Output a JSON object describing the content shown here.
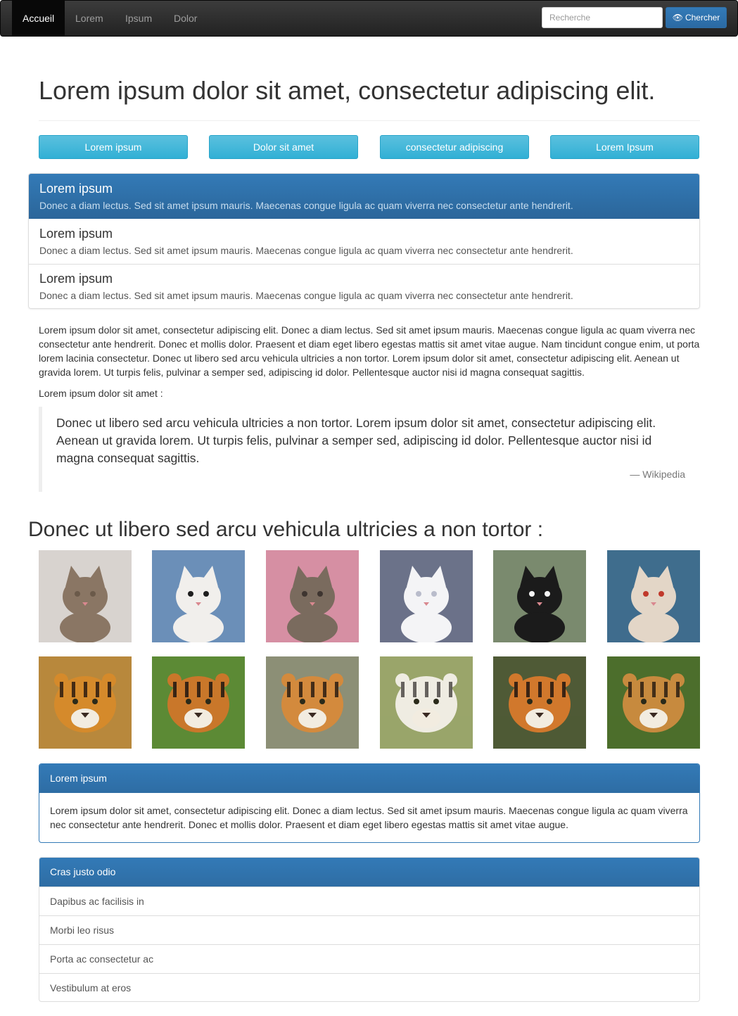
{
  "nav": {
    "items": [
      "Accueil",
      "Lorem",
      "Ipsum",
      "Dolor"
    ],
    "search_placeholder": "Recherche",
    "search_button": "Chercher"
  },
  "page": {
    "title": "Lorem ipsum dolor sit amet, consectetur adipiscing elit.",
    "buttons": [
      "Lorem ipsum",
      "Dolor sit amet",
      "consectetur adipiscing",
      "Lorem Ipsum"
    ]
  },
  "list_group": [
    {
      "heading": "Lorem ipsum",
      "text": "Donec a diam lectus. Sed sit amet ipsum mauris. Maecenas congue ligula ac quam viverra nec consectetur ante hendrerit."
    },
    {
      "heading": "Lorem ipsum",
      "text": "Donec a diam lectus. Sed sit amet ipsum mauris. Maecenas congue ligula ac quam viverra nec consectetur ante hendrerit."
    },
    {
      "heading": "Lorem ipsum",
      "text": "Donec a diam lectus. Sed sit amet ipsum mauris. Maecenas congue ligula ac quam viverra nec consectetur ante hendrerit."
    }
  ],
  "paragraph": "Lorem ipsum dolor sit amet, consectetur adipiscing elit. Donec a diam lectus. Sed sit amet ipsum mauris. Maecenas congue ligula ac quam viverra nec consectetur ante hendrerit. Donec et mollis dolor. Praesent et diam eget libero egestas mattis sit amet vitae augue. Nam tincidunt congue enim, ut porta lorem lacinia consectetur. Donec ut libero sed arcu vehicula ultricies a non tortor. Lorem ipsum dolor sit amet, consectetur adipiscing elit. Aenean ut gravida lorem. Ut turpis felis, pulvinar a semper sed, adipiscing id dolor. Pellentesque auctor nisi id magna consequat sagittis.",
  "intro": "Lorem ipsum dolor sit amet :",
  "blockquote": {
    "text": "Donec ut libero sed arcu vehicula ultricies a non tortor. Lorem ipsum dolor sit amet, consectetur adipiscing elit. Aenean ut gravida lorem. Ut turpis felis, pulvinar a semper sed, adipiscing id dolor. Pellentesque auctor nisi id magna consequat sagittis.",
    "source": "— Wikipedia"
  },
  "section_title": "Donec ut libero sed arcu vehicula ultricies a non tortor :",
  "gallery": {
    "kittens": [
      {
        "bg": "#d8d3cf",
        "fur": "#8a7664",
        "accent": "#6b5a4a"
      },
      {
        "bg": "#6b8fb8",
        "fur": "#f1efec",
        "accent": "#1e1e1e"
      },
      {
        "bg": "#d68fa3",
        "fur": "#7a6b5e",
        "accent": "#3e3530"
      },
      {
        "bg": "#6b7289",
        "fur": "#f4f4f6",
        "accent": "#b9bccb"
      },
      {
        "bg": "#7a8a6e",
        "fur": "#1b1b1b",
        "accent": "#f5f5f5"
      },
      {
        "bg": "#3f6d8d",
        "fur": "#e3d6c7",
        "accent": "#c0392b"
      }
    ],
    "tigers": [
      {
        "bg": "#b8883c",
        "fur": "#d58a2b",
        "accent": "#2b1a10"
      },
      {
        "bg": "#5c8a35",
        "fur": "#c9772a",
        "accent": "#1f1510"
      },
      {
        "bg": "#8c8f76",
        "fur": "#d38a3d",
        "accent": "#2a1c12"
      },
      {
        "bg": "#9aa56a",
        "fur": "#efece2",
        "accent": "#4d4a46"
      },
      {
        "bg": "#4f5a36",
        "fur": "#d1782c",
        "accent": "#211510"
      },
      {
        "bg": "#4c6e2c",
        "fur": "#c78a3e",
        "accent": "#2b1d12"
      }
    ]
  },
  "panel1": {
    "heading": "Lorem ipsum",
    "body": "Lorem ipsum dolor sit amet, consectetur adipiscing elit. Donec a diam lectus. Sed sit amet ipsum mauris. Maecenas congue ligula ac quam viverra nec consectetur ante hendrerit. Donec et mollis dolor. Praesent et diam eget libero egestas mattis sit amet vitae augue."
  },
  "panel2": {
    "heading": "Cras justo odio",
    "items": [
      "Dapibus ac facilisis in",
      "Morbi leo risus",
      "Porta ac consectetur ac",
      "Vestibulum at eros"
    ]
  },
  "colors": {
    "primary": "#337ab7",
    "info": "#5bc0de",
    "navbar": "#222222"
  }
}
